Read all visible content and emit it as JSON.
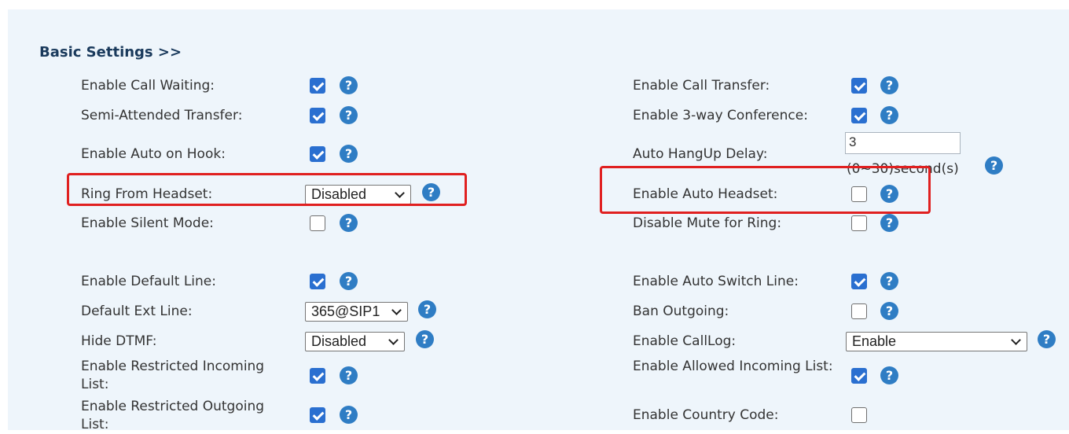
{
  "section_title": "Basic Settings >>",
  "help_glyph": "?",
  "left": {
    "call_waiting": {
      "label": "Enable Call Waiting:",
      "checked": true
    },
    "semi_attended": {
      "label": "Semi-Attended Transfer:",
      "checked": true
    },
    "auto_on_hook": {
      "label": "Enable Auto on Hook:",
      "checked": true
    },
    "ring_from_headset": {
      "label": "Ring From Headset:",
      "value": "Disabled"
    },
    "silent_mode": {
      "label": "Enable Silent Mode:",
      "checked": false
    },
    "default_line": {
      "label": "Enable Default Line:",
      "checked": true
    },
    "default_ext_line": {
      "label": "Default Ext Line:",
      "value": "365@SIP1"
    },
    "hide_dtmf": {
      "label": "Hide DTMF:",
      "value": "Disabled"
    },
    "restricted_incoming": {
      "label": "Enable Restricted Incoming List:",
      "checked": true
    },
    "restricted_outgoing": {
      "label": "Enable Restricted Outgoing List:",
      "checked": true
    }
  },
  "right": {
    "call_transfer": {
      "label": "Enable Call Transfer:",
      "checked": true
    },
    "three_way": {
      "label": "Enable 3-way Conference:",
      "checked": true
    },
    "auto_hangup": {
      "label": "Auto HangUp Delay:",
      "value": "3",
      "hint": "(0~30)second(s)"
    },
    "auto_headset": {
      "label": "Enable Auto Headset:",
      "checked": false
    },
    "disable_mute_ring": {
      "label": "Disable Mute for Ring:",
      "checked": false
    },
    "auto_switch_line": {
      "label": "Enable Auto Switch Line:",
      "checked": true
    },
    "ban_outgoing": {
      "label": "Ban Outgoing:",
      "checked": false
    },
    "calllog": {
      "label": "Enable CallLog:",
      "value": "Enable"
    },
    "allowed_incoming": {
      "label": "Enable Allowed Incoming List:",
      "checked": true
    },
    "country_code": {
      "label": "Enable Country Code:",
      "checked": false
    }
  },
  "colors": {
    "checkbox_on": "#2a6fd0",
    "help_icon": "#2f7dc4",
    "highlight": "#e02020",
    "panel_bg": "#eef5fb"
  }
}
